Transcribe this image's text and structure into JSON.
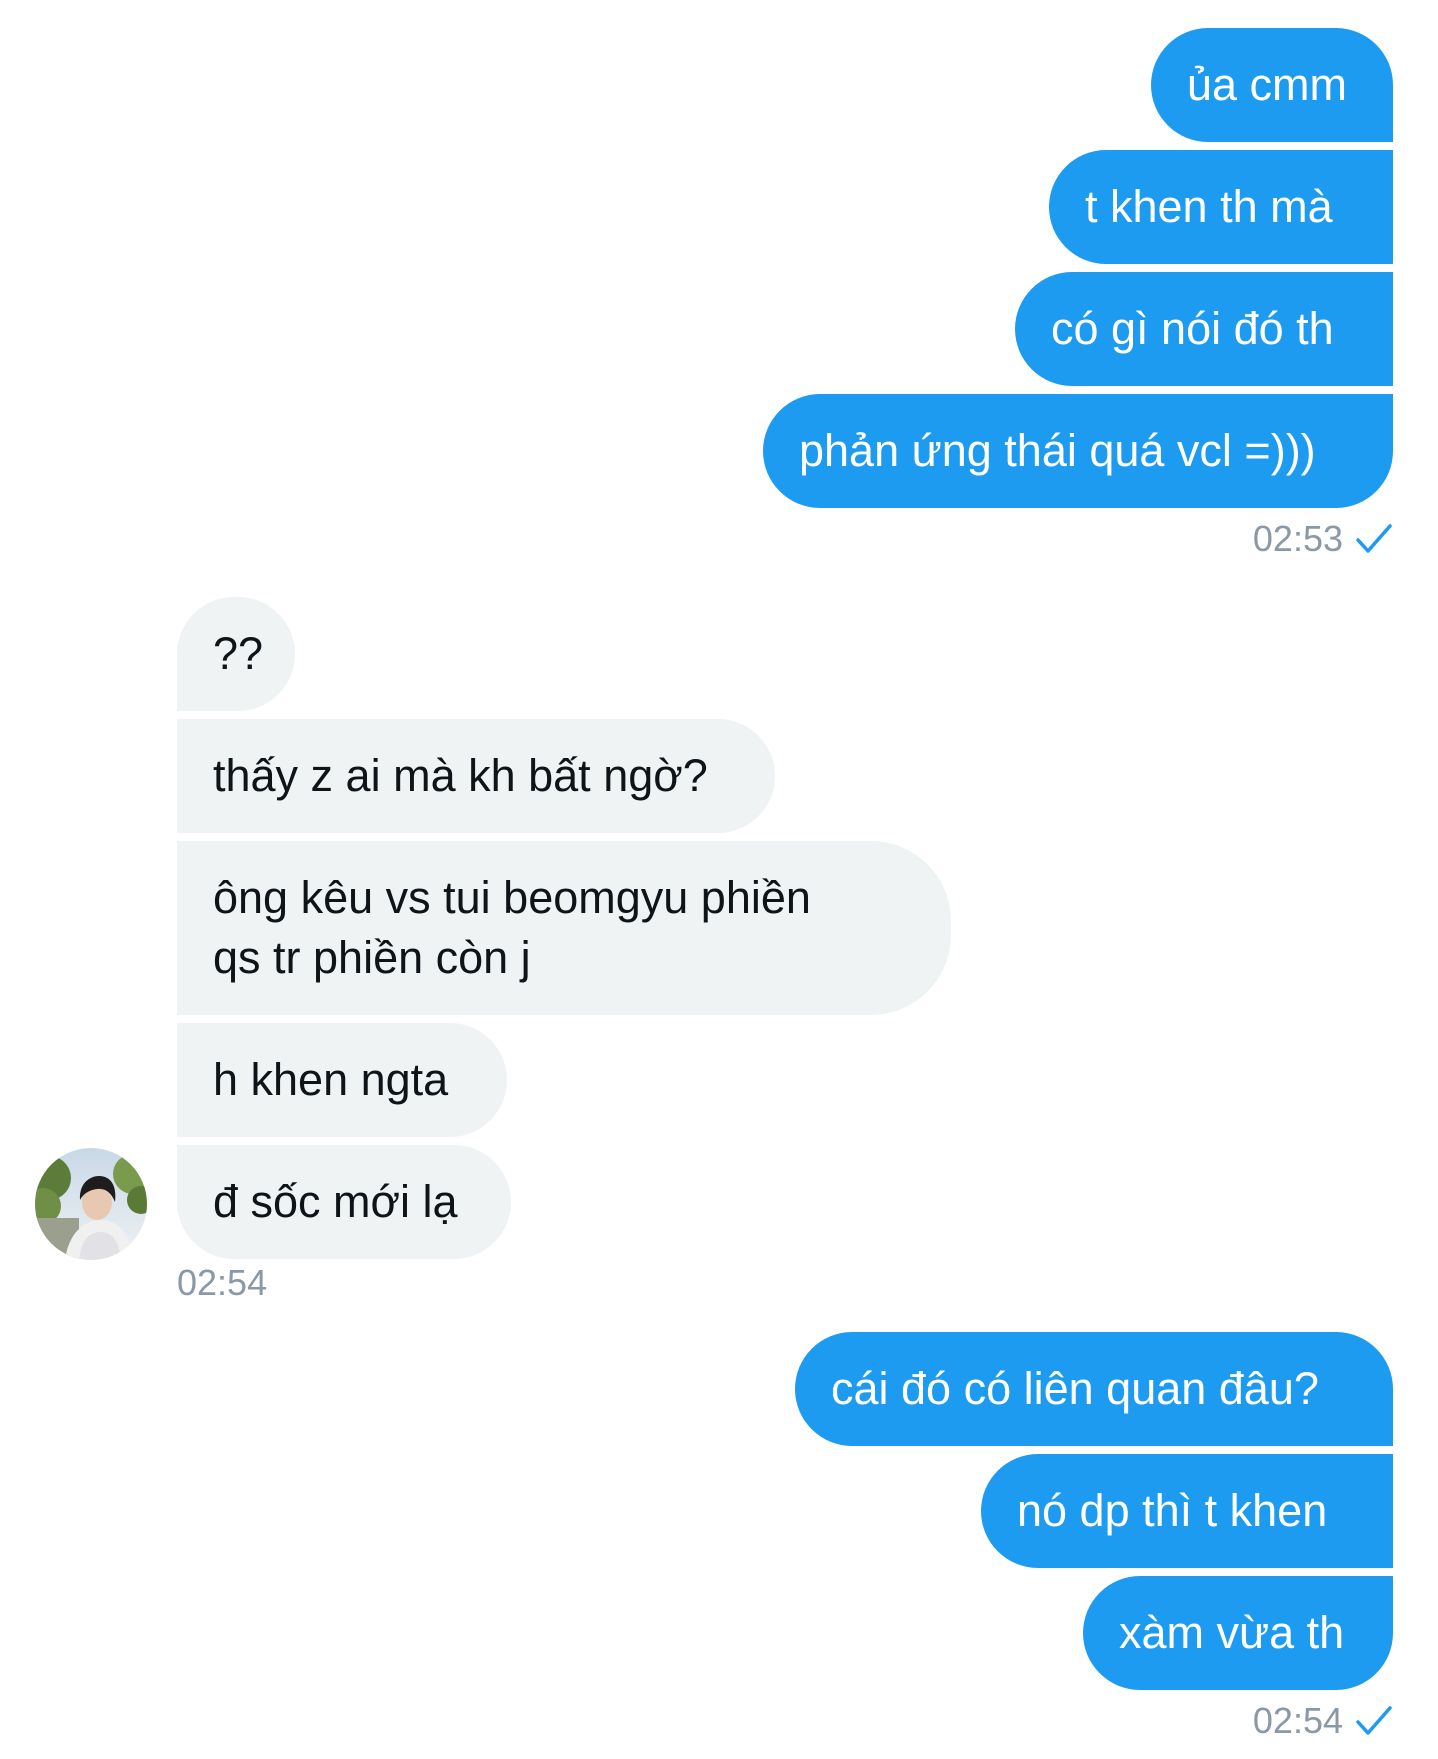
{
  "conversation": {
    "group1": {
      "messages": [
        "ủa cmm",
        "t khen th mà",
        "có gì nói đó th",
        "phản ứng thái quá vcl =)))"
      ],
      "time": "02:53"
    },
    "group2": {
      "messages": [
        "??",
        "thấy z ai mà kh bất ngờ?",
        "ông kêu vs tui beomgyu phiền",
        "qs tr phiền còn j",
        "h khen ngta",
        "đ sốc mới lạ"
      ],
      "time": "02:54"
    },
    "group3": {
      "messages": [
        "cái đó có liên quan đâu?",
        "nó dp thì t khen",
        "xàm vừa th"
      ],
      "time": "02:54"
    }
  },
  "colors": {
    "outgoing_bubble": "#1d9bf0",
    "incoming_bubble": "#eff3f4",
    "timestamp": "#8b98a5",
    "read_check": "#1d9bf0"
  },
  "icons": {
    "read_receipt": "check-icon",
    "contact": "avatar"
  }
}
